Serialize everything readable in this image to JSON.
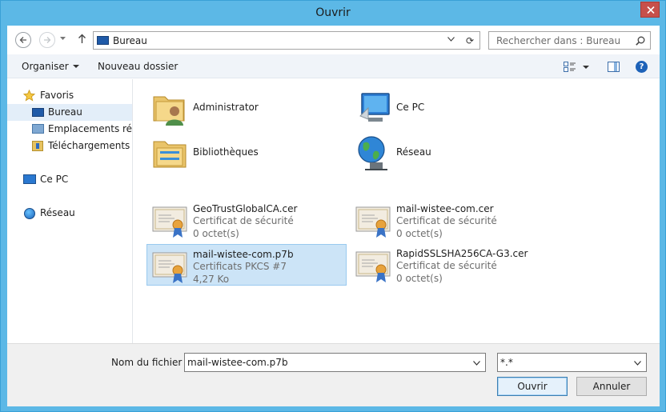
{
  "window": {
    "title": "Ouvrir"
  },
  "address_bar": {
    "location": "Bureau",
    "refresh_glyph": "⟳"
  },
  "search": {
    "placeholder": "Rechercher dans : Bureau"
  },
  "toolbar": {
    "organiser_label": "Organiser",
    "new_folder_label": "Nouveau dossier",
    "help_glyph": "?"
  },
  "sidebar": {
    "items": [
      {
        "label": "Favoris",
        "icon": "star-icon"
      },
      {
        "label": "Bureau",
        "icon": "desktop-icon",
        "selected": true
      },
      {
        "label": "Emplacements récents",
        "icon": "recent-places-icon"
      },
      {
        "label": "Téléchargements",
        "icon": "downloads-icon"
      },
      {
        "label": "Ce PC",
        "icon": "computer-icon"
      },
      {
        "label": "Réseau",
        "icon": "network-icon"
      }
    ]
  },
  "files": [
    {
      "name": "Administrator",
      "type": "",
      "size": "",
      "icon": "user-folder-icon"
    },
    {
      "name": "Ce PC",
      "type": "",
      "size": "",
      "icon": "computer-icon"
    },
    {
      "name": "Bibliothèques",
      "type": "",
      "size": "",
      "icon": "libraries-icon"
    },
    {
      "name": "Réseau",
      "type": "",
      "size": "",
      "icon": "network-globe-icon"
    },
    {
      "name": "GeoTrustGlobalCA.cer",
      "type": "Certificat de sécurité",
      "size": "0 octet(s)",
      "icon": "certificate-icon"
    },
    {
      "name": "mail-wistee-com.cer",
      "type": "Certificat de sécurité",
      "size": "0 octet(s)",
      "icon": "certificate-icon"
    },
    {
      "name": "mail-wistee-com.p7b",
      "type": "Certificats PKCS #7",
      "size": "4,27 Ko",
      "icon": "certificate-icon",
      "selected": true
    },
    {
      "name": "RapidSSLSHA256CA-G3.cer",
      "type": "Certificat de sécurité",
      "size": "0 octet(s)",
      "icon": "certificate-icon"
    }
  ],
  "footer": {
    "filename_label": "Nom du fichier :",
    "filename_value": "mail-wistee-com.p7b",
    "filetype_value": "*.*",
    "open_label": "Ouvrir",
    "cancel_label": "Annuler"
  },
  "colors": {
    "selection_bg": "#cce4f7",
    "selection_border": "#99c9ef",
    "frame": "#5cb8e6",
    "close": "#c7504b"
  }
}
